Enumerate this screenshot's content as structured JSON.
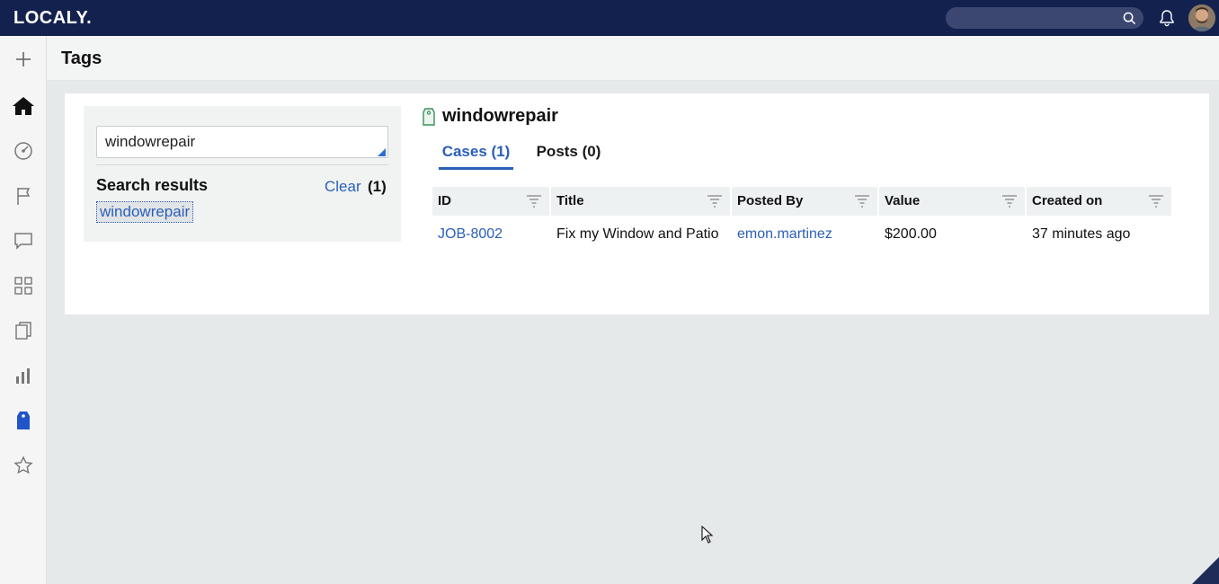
{
  "app": {
    "logo": "LOCALY.",
    "search_placeholder": ""
  },
  "sidebar": {
    "items": [
      {
        "icon": "plus-icon",
        "label": "Create"
      },
      {
        "icon": "home-icon",
        "label": "Home"
      },
      {
        "icon": "dashboard-icon",
        "label": "Dashboard"
      },
      {
        "icon": "flag-icon",
        "label": "Flags"
      },
      {
        "icon": "comment-icon",
        "label": "Messages"
      },
      {
        "icon": "grid-icon",
        "label": "Apps"
      },
      {
        "icon": "documents-icon",
        "label": "Documents"
      },
      {
        "icon": "chart-icon",
        "label": "Reports"
      },
      {
        "icon": "tag-icon",
        "label": "Tags"
      },
      {
        "icon": "star-icon",
        "label": "Favorites"
      }
    ]
  },
  "header": {
    "title": "Tags"
  },
  "search_panel": {
    "input_value": "windowrepair",
    "results_label": "Search results",
    "clear_label": "Clear",
    "count": "(1)",
    "results": [
      "windowrepair"
    ]
  },
  "tag_view": {
    "tag_name": "windowrepair",
    "tabs": [
      {
        "label": "Cases (1)",
        "active": true
      },
      {
        "label": "Posts (0)",
        "active": false
      }
    ],
    "columns": [
      "ID",
      "Title",
      "Posted By",
      "Value",
      "Created on"
    ],
    "rows": [
      {
        "id": "JOB-8002",
        "title": "Fix my Window and Patio",
        "posted_by": "emon.martinez",
        "value": "$200.00",
        "created_on": "37 minutes ago"
      }
    ]
  },
  "colors": {
    "topbar": "#13214f",
    "accent": "#2b5fb8",
    "tag_green": "#3a8f5c"
  }
}
